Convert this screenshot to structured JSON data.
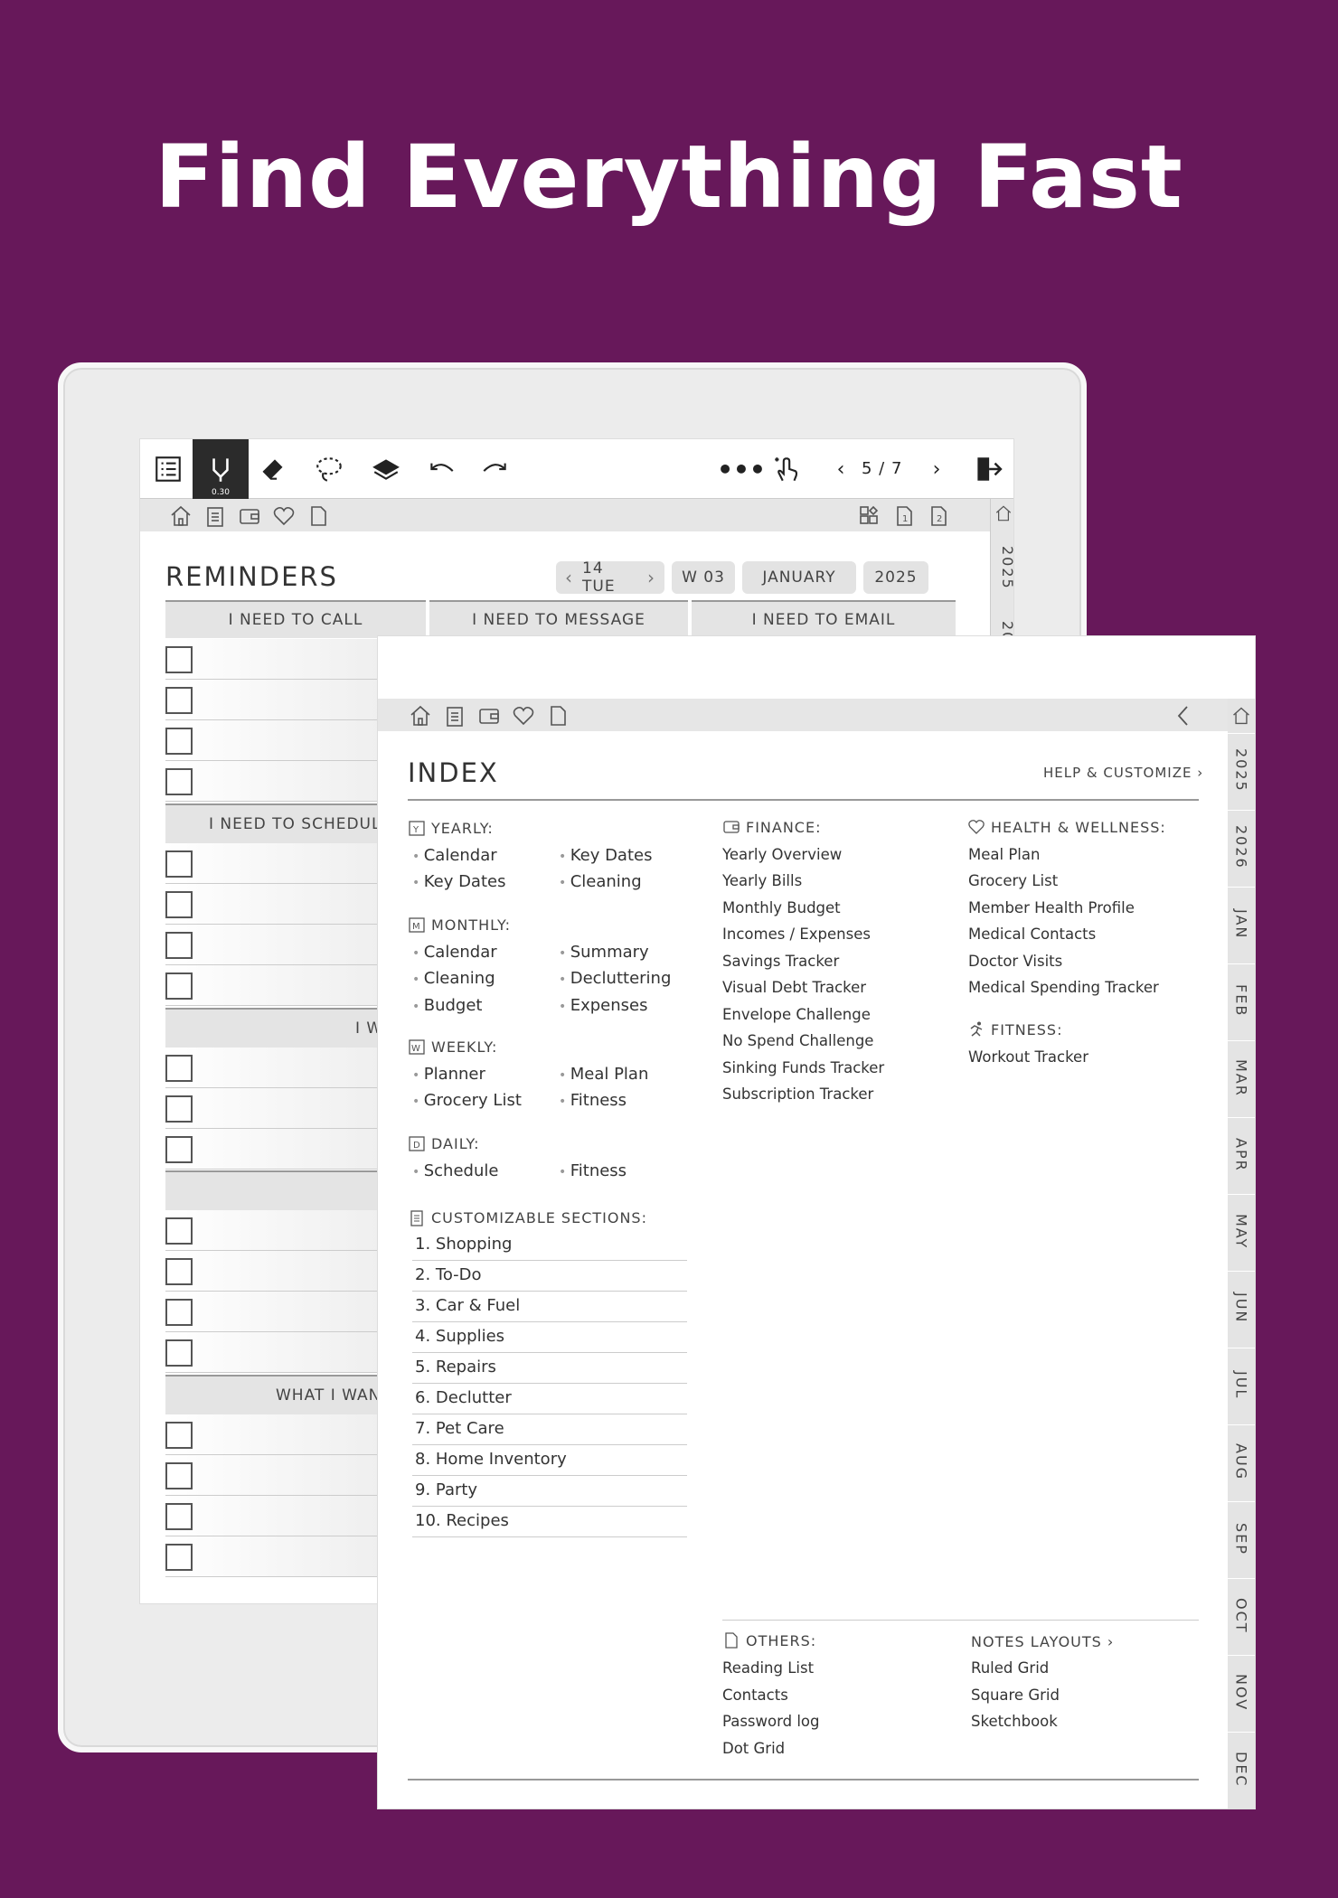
{
  "headline": "Find Everything Fast",
  "toolbar": {
    "pen_size": "0.30",
    "page_indicator": "5 / 7"
  },
  "reminders": {
    "title": "REMINDERS",
    "day": "14 TUE",
    "week": "W 03",
    "month": "JANUARY",
    "year": "2025",
    "columns": [
      "I NEED TO CALL",
      "I NEED TO MESSAGE",
      "I NEED TO EMAIL"
    ],
    "sections": [
      "I NEED TO SCHEDULE",
      "I W",
      "",
      "WHAT I WAN"
    ],
    "side_tabs": [
      "2025",
      "20"
    ]
  },
  "index": {
    "title": "INDEX",
    "help_label": "HELP & CUSTOMIZE",
    "yearly": {
      "label": "YEARLY:",
      "icon": "Y",
      "items": [
        "Calendar",
        "Key Dates",
        "Key Dates",
        "Cleaning"
      ]
    },
    "monthly": {
      "label": "MONTHLY:",
      "icon": "M",
      "items": [
        "Calendar",
        "Cleaning",
        "Budget",
        "Summary",
        "Decluttering",
        "Expenses"
      ]
    },
    "weekly": {
      "label": "WEEKLY:",
      "icon": "W",
      "items": [
        "Planner",
        "Grocery List",
        "Meal Plan",
        "Fitness"
      ]
    },
    "daily": {
      "label": "DAILY:",
      "icon": "D",
      "items": [
        "Schedule",
        "Fitness"
      ]
    },
    "custom": {
      "label": "CUSTOMIZABLE SECTIONS:",
      "items": [
        "1. Shopping",
        "2. To-Do",
        "3. Car & Fuel",
        "4. Supplies",
        "5. Repairs",
        "6. Declutter",
        "7. Pet Care",
        "8. Home Inventory",
        "9. Party",
        "10. Recipes"
      ]
    },
    "finance": {
      "label": "FINANCE:",
      "items": [
        "Yearly Overview",
        "Yearly Bills",
        "Monthly Budget",
        "Incomes / Expenses",
        "Savings Tracker",
        "Visual Debt Tracker",
        "Envelope Challenge",
        "No Spend Challenge",
        "Sinking Funds Tracker",
        "Subscription Tracker"
      ]
    },
    "health": {
      "label": "HEALTH & WELLNESS:",
      "items": [
        "Meal Plan",
        "Grocery List",
        "Member Health Profile",
        "Medical Contacts",
        "Doctor Visits",
        "Medical Spending Tracker"
      ]
    },
    "fitness": {
      "label": "FITNESS:",
      "items": [
        "Workout Tracker"
      ]
    },
    "others": {
      "label": "OTHERS:",
      "items": [
        "Reading List",
        "Contacts",
        "Password log",
        "Dot Grid"
      ]
    },
    "notes": {
      "label": "NOTES LAYOUTS",
      "items": [
        "Ruled Grid",
        "Square Grid",
        "Sketchbook"
      ]
    },
    "side_tabs": [
      "2025",
      "2026",
      "JAN",
      "FEB",
      "MAR",
      "APR",
      "MAY",
      "JUN",
      "JUL",
      "AUG",
      "SEP",
      "OCT",
      "NOV",
      "DEC"
    ]
  },
  "colors": {
    "background": "#67185a",
    "tab_gray": "#e4e4e4",
    "text": "#333333"
  }
}
